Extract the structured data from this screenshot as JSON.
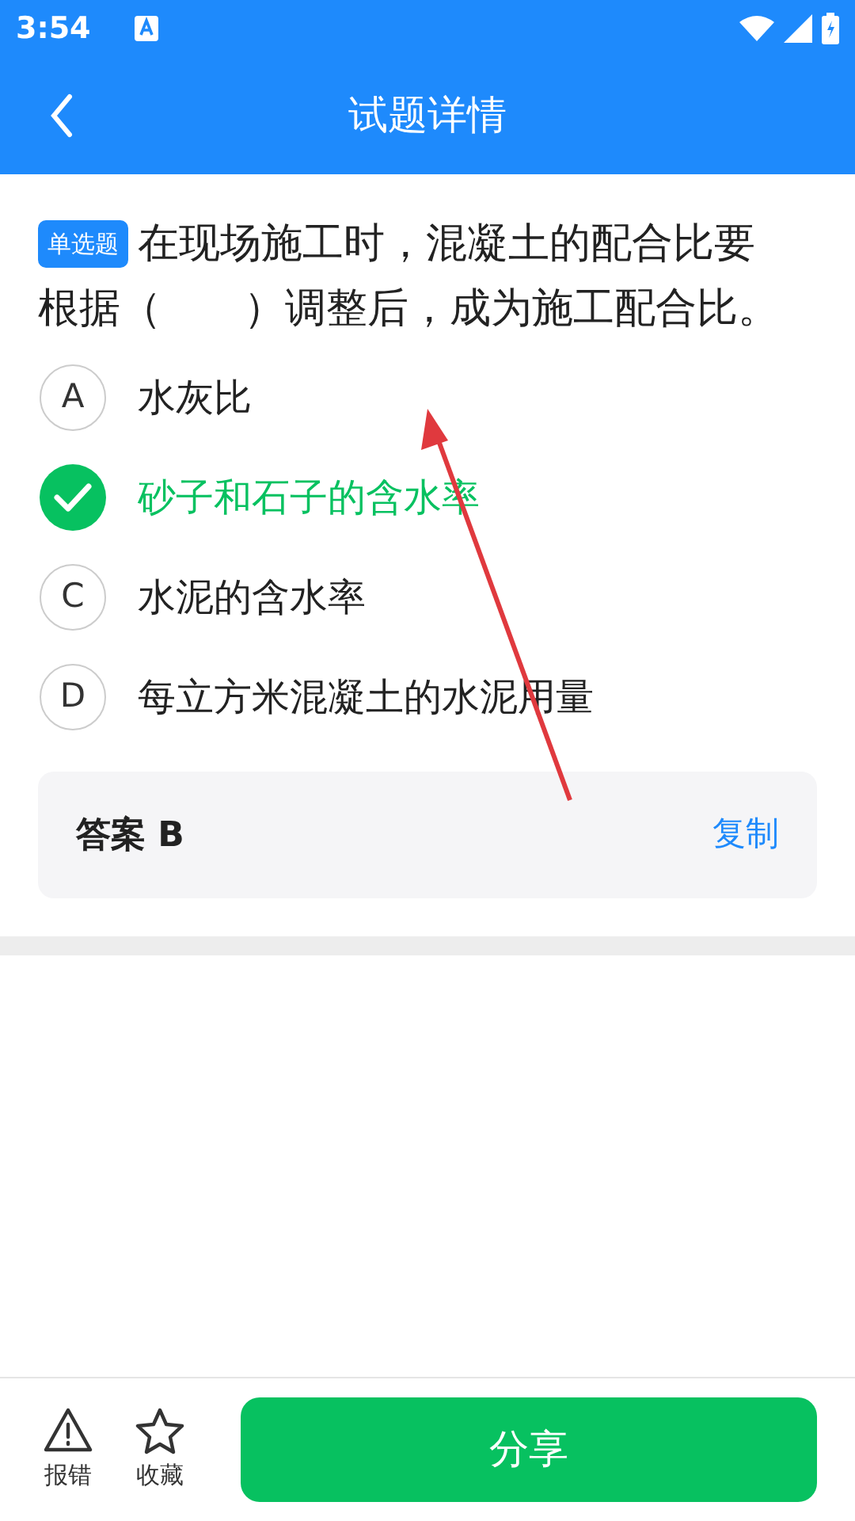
{
  "status_bar": {
    "time": "3:54"
  },
  "header": {
    "title": "试题详情"
  },
  "question": {
    "tag": "单选题",
    "text": "在现场施工时，混凝土的配合比要根据（　　）调整后，成为施工配合比。"
  },
  "options": [
    {
      "letter": "A",
      "text": "水灰比",
      "selected": false
    },
    {
      "text": "砂子和石子的含水率",
      "selected": true
    },
    {
      "letter": "C",
      "text": "水泥的含水率",
      "selected": false
    },
    {
      "letter": "D",
      "text": "每立方米混凝土的水泥用量",
      "selected": false
    }
  ],
  "answer": {
    "text": "答案 B",
    "copy": "复制"
  },
  "bottom_bar": {
    "actions": [
      {
        "kind": "report",
        "label": "报错"
      },
      {
        "kind": "favorite",
        "label": "收藏"
      }
    ],
    "share": "分享"
  }
}
